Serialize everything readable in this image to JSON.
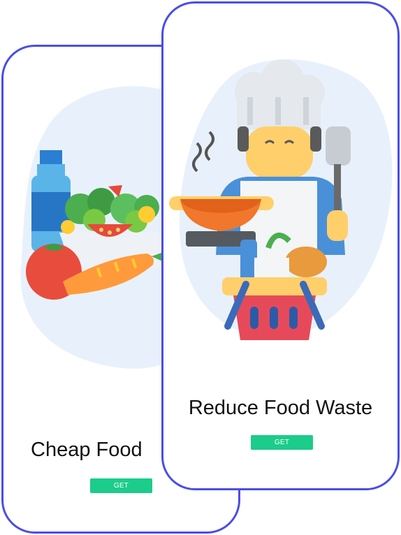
{
  "screens": [
    {
      "id": "back",
      "title": "Cheap Food",
      "cta_label": "GET STARTED",
      "illustration_icon": "salad-vegetables-icon"
    },
    {
      "id": "front",
      "title": "Reduce Food Waste",
      "cta_label": "GET STARTED",
      "illustration_icon": "chef-cooking-icon"
    }
  ],
  "colors": {
    "frame_border": "#4a4de6",
    "cta_background": "#1ccc8a",
    "cta_text": "#ffffff",
    "title_text": "#121212",
    "blob_background": "#e8f1fb"
  }
}
